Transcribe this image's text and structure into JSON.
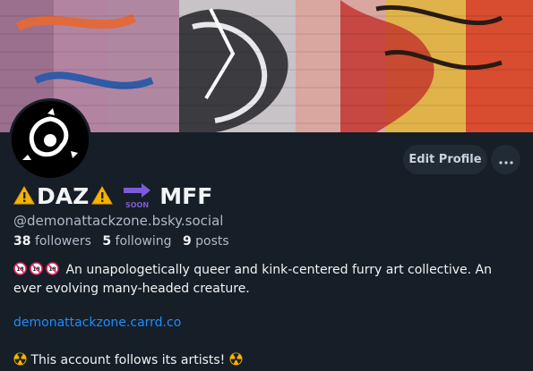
{
  "profile": {
    "display_name_main": "DAZ",
    "display_name_suffix": "MFF",
    "soon_label": "SOON",
    "handle": "@demonattackzone.bsky.social",
    "followers_count": "38",
    "followers_label": "followers",
    "following_count": "5",
    "following_label": "following",
    "posts_count": "9",
    "posts_label": "posts",
    "bio_line1": "An unapologetically queer and kink-centered furry art collective. An",
    "bio_line2": "ever evolving many-headed creature.",
    "link": "demonattackzone.carrd.co",
    "follows_note": "This account follows its artists!"
  },
  "actions": {
    "edit_profile_label": "Edit Profile"
  },
  "icons": {
    "warning": "warning-icon",
    "soon_arrow": "soon-arrow-icon",
    "no_under_18": "no-under-18-icon",
    "radioactive": "radioactive-icon",
    "more": "more-horizontal-icon"
  },
  "colors": {
    "background": "#161e27",
    "button_bg": "#212b36",
    "link": "#208bfe",
    "muted_text": "#aebbc9"
  }
}
